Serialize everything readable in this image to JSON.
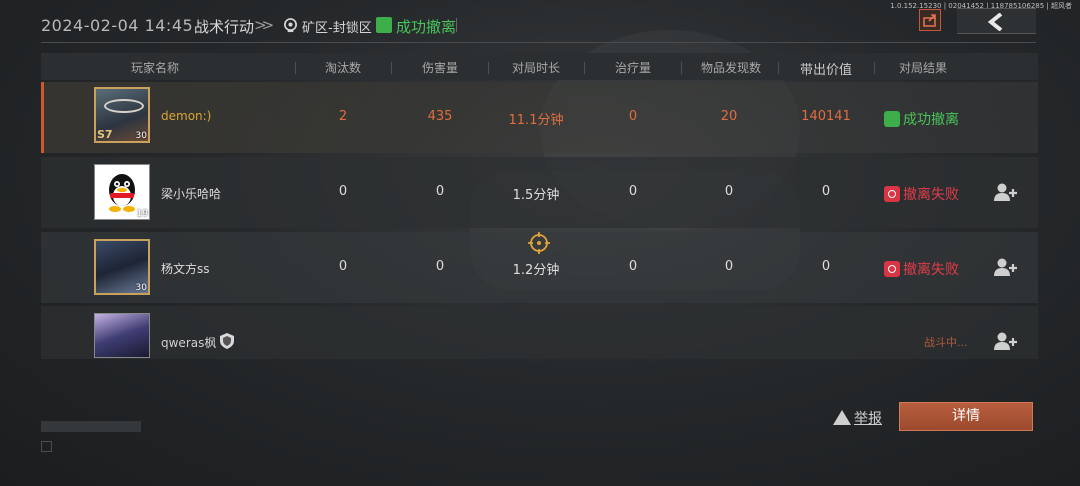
{
  "header": {
    "datetime": "2024-02-04 14:45",
    "mode": "战术行动",
    "map": "矿区-封锁区",
    "result": "成功撤离",
    "corner_info": "1.0.152.15230 | 02041452 | 118785106285 | 超风者"
  },
  "columns": [
    "玩家名称",
    "淘汰数",
    "伤害量",
    "对局时长",
    "治疗量",
    "物品发现数",
    "带出价值",
    "对局结果"
  ],
  "players": [
    {
      "name": "demon:)",
      "badge": "S7",
      "level": "30",
      "eliminations": "2",
      "damage": "435",
      "duration": "11.1分钟",
      "healing": "0",
      "items_found": "20",
      "value": "140141",
      "result": "成功撤离"
    },
    {
      "name": "梁小乐哈哈",
      "level": "19",
      "eliminations": "0",
      "damage": "0",
      "duration": "1.5分钟",
      "healing": "0",
      "items_found": "0",
      "value": "0",
      "result": "撤离失败"
    },
    {
      "name": "杨文方ss",
      "level": "30",
      "eliminations": "0",
      "damage": "0",
      "duration": "1.2分钟",
      "healing": "0",
      "items_found": "0",
      "value": "0",
      "result": "撤离失败"
    },
    {
      "name": "qweras枫",
      "status": "战斗中..."
    }
  ],
  "footer": {
    "report_label": "举报",
    "detail_label": "详情"
  },
  "colors": {
    "accent": "#d0572f",
    "success": "#49c35a",
    "fail": "#e23b4a",
    "highlight_value": "#e06d3e"
  }
}
